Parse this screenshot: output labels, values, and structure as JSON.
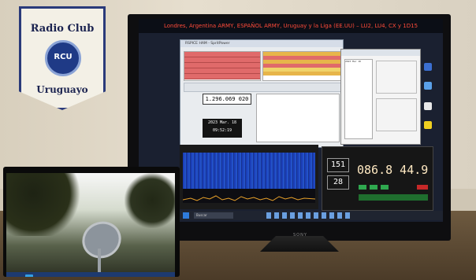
{
  "banner": {
    "line1": "Radio Club",
    "line2": "Uruguayo",
    "logo": "RCU"
  },
  "monitor": {
    "brand": "SONY"
  },
  "screen_title": "Londres, Argentina ARMY, ESPAÑOL ARMY, Uruguay y la Liga (EE.UU) – LU2, LU4, CX y 1D15",
  "main_window": {
    "title": "RSPICE HAM - SpritPower",
    "frequency": "1.296.069 020",
    "clock_date": "2023 Mar. 18",
    "clock_time": "09:52:19"
  },
  "dialog": {
    "header": "2023 Mar 18"
  },
  "radio": {
    "left_top": "151",
    "left_bottom": "28",
    "frequency": "086.8  44.9"
  },
  "taskbar": {
    "search": "Buscar"
  },
  "colors": {
    "waterfall": "#1b3fb8",
    "alert_rows": "#e06a6a",
    "radio_digits": "#ffe9c2"
  }
}
